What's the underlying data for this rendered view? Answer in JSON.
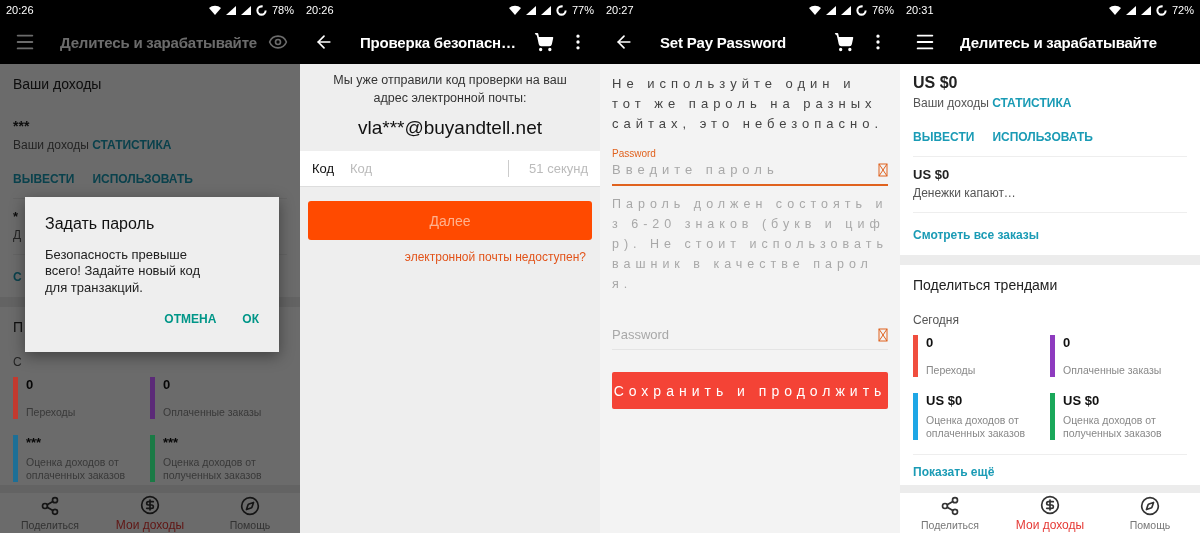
{
  "screens": [
    {
      "kind": "earnings",
      "dimmed": true,
      "status": {
        "time": "20:26",
        "battery": "78%"
      },
      "toolbar": {
        "kind": "menu_eye",
        "title": "Делитесь и зарабатывайте"
      },
      "summary": {
        "heading": "Ваши доходы",
        "amount": "***",
        "label": "Ваши доходы",
        "link": "СТАТИСТИКА",
        "actions": [
          "ВЫВЕСТИ",
          "ИСПОЛЬЗОВАТЬ"
        ]
      },
      "second_card": {
        "amount": "*",
        "label": "Д",
        "link": "С"
      },
      "trends": {
        "heading": "П",
        "period": "С",
        "stats": [
          {
            "value": "0",
            "label": "Переходы",
            "color": "#c23a2f"
          },
          {
            "value": "0",
            "label": "Оплаченные заказы",
            "color": "#5b2a78"
          },
          {
            "value": "***",
            "label": "Оценка доходов от оплаченных заказов",
            "color": "#1d6f96"
          },
          {
            "value": "***",
            "label": "Оценка доходов от полученных заказов",
            "color": "#1a7a45"
          }
        ]
      },
      "dialog": {
        "title": "Задать пароль",
        "message": "Безопасность превыше всего! Задайте новый код для транзакций.",
        "buttons": [
          "ОТМЕНА",
          "ОК"
        ]
      },
      "bottom_nav": [
        {
          "label": "Поделиться",
          "selected": false
        },
        {
          "label": "Мои доходы",
          "selected": true
        },
        {
          "label": "Помощь",
          "selected": false
        }
      ]
    },
    {
      "kind": "verify",
      "status": {
        "time": "20:26",
        "battery": "77%"
      },
      "toolbar": {
        "kind": "back_cart",
        "title": "Проверка безопасн…"
      },
      "message": "Мы уже отправили код проверки на ваш адрес электронной почты:",
      "email": "vla***@buyandtell.net",
      "code_field": {
        "label": "Код",
        "placeholder": "Код",
        "timer": "51 секунд"
      },
      "button": "Далее",
      "link": "электронной почты недоступен?"
    },
    {
      "kind": "set_password",
      "status": {
        "time": "20:27",
        "battery": "76%"
      },
      "toolbar": {
        "kind": "back_cart",
        "title": "Set Pay Password"
      },
      "warning": "Не используйте один и тот же пароль на разных сайтах, это небезопасно.",
      "fields": [
        {
          "label": "Password",
          "placeholder": "Введите пароль",
          "focused": true
        },
        {
          "placeholder": "Password",
          "focused": false
        }
      ],
      "hint": "Пароль должен состоять из 6-20 знаков (букв и цифр). Не стоит использовать вашник в качестве пароля.",
      "button": "Сохранить и продолжить"
    },
    {
      "kind": "earnings",
      "status": {
        "time": "20:31",
        "battery": "72%"
      },
      "toolbar": {
        "kind": "menu",
        "title": "Делитесь и зарабатывайте"
      },
      "summary": {
        "amount": "US $0",
        "label": "Ваши доходы",
        "link": "СТАТИСТИКА",
        "actions": [
          "ВЫВЕСТИ",
          "ИСПОЛЬЗОВАТЬ"
        ]
      },
      "second_card": {
        "amount": "US $0",
        "label": "Денежки капают…",
        "link": "Смотреть все заказы"
      },
      "trends": {
        "heading": "Поделиться трендами",
        "period": "Сегодня",
        "stats": [
          {
            "value": "0",
            "label": "Переходы",
            "color": "#f04e3e"
          },
          {
            "value": "0",
            "label": "Оплаченные заказы",
            "color": "#8e3bbf"
          },
          {
            "value": "US $0",
            "label": "Оценка доходов от оплаченных заказов",
            "color": "#1ea7e6"
          },
          {
            "value": "US $0",
            "label": "Оценка доходов от полученных заказов",
            "color": "#1aa85a"
          }
        ],
        "more": "Показать ещё"
      },
      "bottom_nav": [
        {
          "label": "Поделиться",
          "selected": false
        },
        {
          "label": "Мои доходы",
          "selected": true
        },
        {
          "label": "Помощь",
          "selected": false
        }
      ]
    }
  ]
}
